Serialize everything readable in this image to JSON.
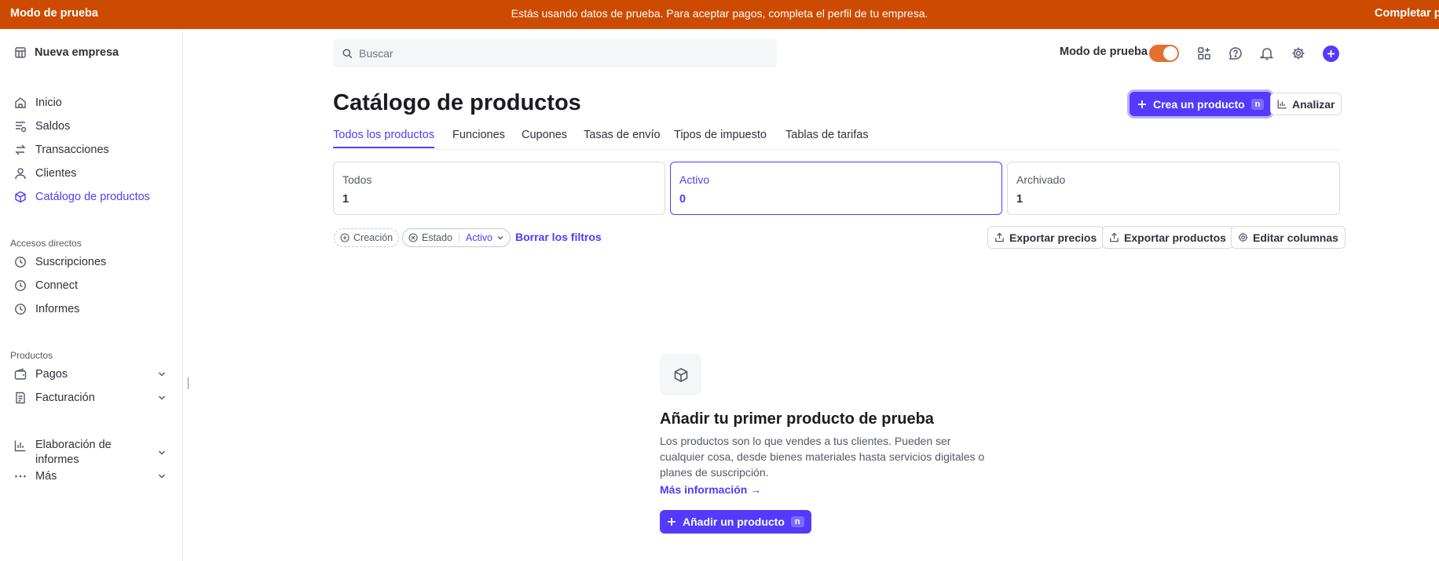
{
  "banner": {
    "left": "Modo de prueba",
    "center": "Estás usando datos de prueba. Para aceptar pagos, completa el perfil de tu empresa.",
    "right": "Completar perfil"
  },
  "sidebar": {
    "company": "Nueva empresa",
    "items": [
      {
        "label": "Inicio",
        "icon": "home-icon"
      },
      {
        "label": "Saldos",
        "icon": "balances-icon"
      },
      {
        "label": "Transacciones",
        "icon": "transactions-icon"
      },
      {
        "label": "Clientes",
        "icon": "person-icon"
      },
      {
        "label": "Catálogo de productos",
        "icon": "box-icon",
        "active": true
      }
    ],
    "shortcuts_title": "Accesos directos",
    "shortcuts": [
      {
        "label": "Suscripciones",
        "icon": "clock-icon"
      },
      {
        "label": "Connect",
        "icon": "clock-icon"
      },
      {
        "label": "Informes",
        "icon": "clock-icon"
      }
    ],
    "products_title": "Productos",
    "products": [
      {
        "label": "Pagos",
        "icon": "wallet-icon"
      },
      {
        "label": "Facturación",
        "icon": "invoice-icon"
      },
      {
        "label": "Elaboración de informes",
        "icon": "chart-icon"
      },
      {
        "label": "Más",
        "icon": "more-icon"
      }
    ]
  },
  "search": {
    "placeholder": "Buscar"
  },
  "topbar": {
    "test_mode_label": "Modo de prueba",
    "test_mode_on": true
  },
  "header": {
    "title": "Catálogo de productos",
    "create_button": "Crea un producto",
    "create_shortcut": "n",
    "analyze_button": "Analizar"
  },
  "tabs": [
    "Todos los productos",
    "Funciones",
    "Cupones",
    "Tasas de envío",
    "Tipos de impuesto",
    "Tablas de tarifas"
  ],
  "status_cards": [
    {
      "label": "Todos",
      "count": "1"
    },
    {
      "label": "Activo",
      "count": "0",
      "active": true
    },
    {
      "label": "Archivado",
      "count": "1"
    }
  ],
  "filters": {
    "created": "Creación",
    "status_label": "Estado",
    "status_value": "Activo",
    "clear": "Borrar los filtros"
  },
  "actions": {
    "export_prices": "Exportar precios",
    "export_products": "Exportar productos",
    "edit_columns": "Editar columnas"
  },
  "empty_state": {
    "title": "Añadir tu primer producto de prueba",
    "description": "Los productos son lo que vendes a tus clientes. Pueden ser cualquier cosa, desde bienes materiales hasta servicios digitales o planes de suscripción.",
    "more_link": "Más información →",
    "add_button": "Añadir un producto",
    "add_shortcut": "n"
  },
  "colors": {
    "accent": "#533afd",
    "banner": "#cc4b00",
    "toggle": "#e46f2e"
  }
}
